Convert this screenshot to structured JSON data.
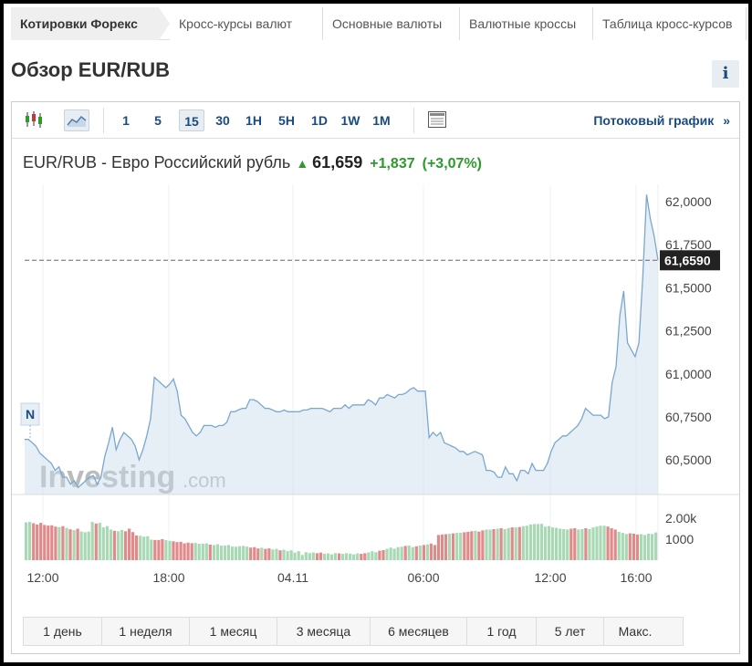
{
  "tabs": [
    {
      "label": "Котировки Форекс",
      "active": true
    },
    {
      "label": "Кросс-курсы валют"
    },
    {
      "label": "Основные валюты"
    },
    {
      "label": "Валютные кроссы"
    },
    {
      "label": "Таблица кросс-курсов"
    }
  ],
  "page": {
    "title": "Обзор EUR/RUB",
    "info_icon": "i"
  },
  "toolbar": {
    "chart_type_icons": [
      "candlestick-icon",
      "area-chart-icon"
    ],
    "intervals": [
      {
        "label": "1"
      },
      {
        "label": "5"
      },
      {
        "label": "15",
        "active": true
      },
      {
        "label": "30"
      },
      {
        "label": "1H"
      },
      {
        "label": "5H"
      },
      {
        "label": "1D"
      },
      {
        "label": "1W"
      },
      {
        "label": "1M"
      }
    ],
    "layout_icon": "table-layout-icon",
    "stream_label": "Потоковый график",
    "stream_chevron": "»"
  },
  "quote": {
    "name": "EUR/RUB - Евро Российский рубль",
    "arrow": "🠅",
    "price": "61,659",
    "change": "+1,837",
    "change_pct": "(+3,07%)"
  },
  "chart_data": {
    "type": "area",
    "x_tick_labels": [
      "12:00",
      "18:00",
      "04.11",
      "06:00",
      "12:00",
      "16:00"
    ],
    "y_tick_labels": [
      "62,0000",
      "61,7500",
      "61,5000",
      "61,2500",
      "61,0000",
      "60,7500",
      "60,5000"
    ],
    "ylim": [
      60.3,
      62.1
    ],
    "current_value_label": "61,6590",
    "current_value": 61.659,
    "news_marker": "N",
    "watermark": "Investing.com",
    "volume_tick_labels": [
      "2.00k",
      "1000"
    ],
    "price_values": [
      60.62,
      60.62,
      60.6,
      60.58,
      60.54,
      60.52,
      60.5,
      60.48,
      60.44,
      60.46,
      60.4,
      60.4,
      60.36,
      60.38,
      60.34,
      60.36,
      60.38,
      60.4,
      60.41,
      60.36,
      60.4,
      60.52,
      60.6,
      60.69,
      60.56,
      60.62,
      60.66,
      60.64,
      60.62,
      60.58,
      60.5,
      60.56,
      60.64,
      60.74,
      60.98,
      60.96,
      60.94,
      60.92,
      60.94,
      60.97,
      60.9,
      60.76,
      60.74,
      60.7,
      60.66,
      60.64,
      60.66,
      60.7,
      60.7,
      60.7,
      60.69,
      60.7,
      60.7,
      60.72,
      60.78,
      60.78,
      60.79,
      60.8,
      60.8,
      60.85,
      60.85,
      60.84,
      60.82,
      60.8,
      60.8,
      60.79,
      60.78,
      60.78,
      60.79,
      60.78,
      60.78,
      60.78,
      60.78,
      60.79,
      60.79,
      60.8,
      60.8,
      60.8,
      60.8,
      60.79,
      60.78,
      60.8,
      60.8,
      60.8,
      60.82,
      60.8,
      60.82,
      60.82,
      60.82,
      60.82,
      60.85,
      60.84,
      60.82,
      60.86,
      60.86,
      60.88,
      60.87,
      60.86,
      60.88,
      60.88,
      60.89,
      60.91,
      60.92,
      60.9,
      60.9,
      60.9,
      60.63,
      60.66,
      60.64,
      60.66,
      60.6,
      60.59,
      60.58,
      60.57,
      60.55,
      60.55,
      60.53,
      60.54,
      60.55,
      60.54,
      60.53,
      60.44,
      60.44,
      60.43,
      60.4,
      60.4,
      60.46,
      60.42,
      60.42,
      60.38,
      60.44,
      60.44,
      60.42,
      60.48,
      60.44,
      60.44,
      60.44,
      60.48,
      60.55,
      60.6,
      60.62,
      60.64,
      60.64,
      60.66,
      60.68,
      60.7,
      60.74,
      60.8,
      60.78,
      60.76,
      60.76,
      60.76,
      60.74,
      60.75,
      60.95,
      61.04,
      61.34,
      61.48,
      61.18,
      61.14,
      61.1,
      61.18,
      61.56,
      62.04,
      61.9,
      61.8,
      61.659
    ],
    "volume_values": [
      1800,
      1820,
      1760,
      1700,
      1780,
      1680,
      1650,
      1660,
      1600,
      1580,
      1620,
      1540,
      1470,
      1430,
      1500,
      1370,
      1330,
      1360,
      1820,
      1750,
      1780,
      1560,
      1620,
      1460,
      1400,
      1380,
      1440,
      1380,
      1500,
      1340,
      1180,
      1160,
      1120,
      1140,
      980,
      960,
      960,
      1000,
      950,
      920,
      900,
      860,
      880,
      800,
      840,
      810,
      820,
      780,
      790,
      800,
      740,
      720,
      760,
      690,
      700,
      720,
      650,
      640,
      670,
      680,
      650,
      600,
      620,
      560,
      590,
      540,
      560,
      510,
      540,
      470,
      500,
      430,
      470,
      360,
      430,
      250,
      380,
      340,
      370,
      330,
      360,
      310,
      320,
      280,
      340,
      320,
      300,
      330,
      310,
      280,
      320,
      300,
      330,
      370,
      420,
      380,
      450,
      480,
      540,
      600,
      550,
      620,
      640,
      680,
      700,
      620,
      660,
      700,
      720,
      750,
      790,
      720,
      1200,
      1220,
      1240,
      1260,
      1280,
      1300,
      1310,
      1330,
      1350,
      1380,
      1400,
      1360,
      1420,
      1460,
      1450,
      1480,
      1500,
      1520,
      1480,
      1530,
      1560,
      1560,
      1580,
      1620,
      1640,
      1700,
      1720,
      1720,
      1730,
      1600,
      1620,
      1560,
      1540,
      1500,
      1480,
      1460,
      1500,
      1520,
      1460,
      1480,
      1520,
      1480,
      1560,
      1600,
      1640,
      1640,
      1600,
      1520,
      1460,
      1350,
      1300,
      1250,
      1280,
      1260,
      1220,
      1240,
      1200,
      1260,
      1250,
      1320
    ]
  }
}
